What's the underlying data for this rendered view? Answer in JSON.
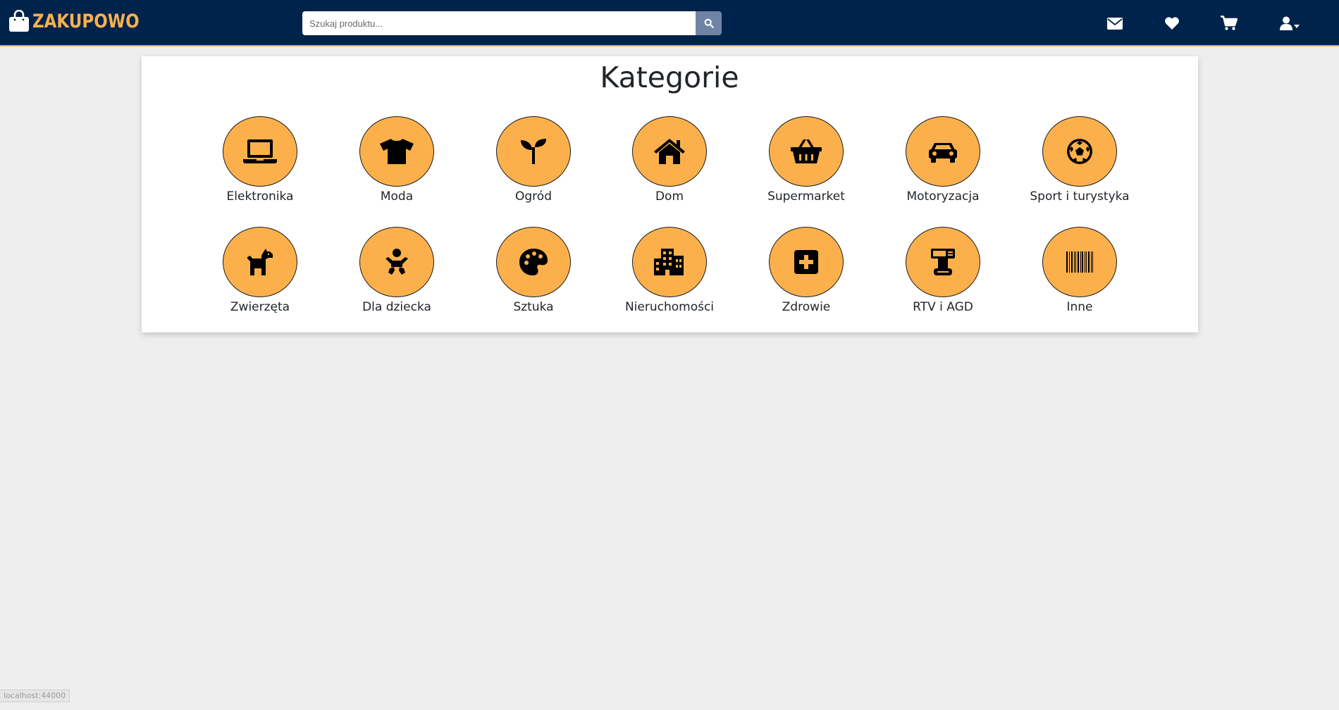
{
  "header": {
    "brand": "ZAKUPOWO",
    "search_placeholder": "Szukaj produktu...",
    "colors": {
      "background": "#00234b",
      "accent": "#f8b04d",
      "search_button": "#6f84a5"
    },
    "icons": [
      "envelope-icon",
      "heart-icon",
      "cart-icon",
      "user-icon"
    ]
  },
  "main": {
    "title": "Kategorie",
    "category_color": "#fcb04c",
    "categories": [
      {
        "label": "Elektronika",
        "icon": "laptop-icon"
      },
      {
        "label": "Moda",
        "icon": "tshirt-icon"
      },
      {
        "label": "Ogród",
        "icon": "seedling-icon"
      },
      {
        "label": "Dom",
        "icon": "home-icon"
      },
      {
        "label": "Supermarket",
        "icon": "basket-icon"
      },
      {
        "label": "Motoryzacja",
        "icon": "car-icon"
      },
      {
        "label": "Sport i turystyka",
        "icon": "football-icon"
      },
      {
        "label": "Zwierzęta",
        "icon": "dog-icon"
      },
      {
        "label": "Dla dziecka",
        "icon": "baby-icon"
      },
      {
        "label": "Sztuka",
        "icon": "palette-icon"
      },
      {
        "label": "Nieruchomości",
        "icon": "building-icon"
      },
      {
        "label": "Zdrowie",
        "icon": "medkit-icon"
      },
      {
        "label": "RTV i AGD",
        "icon": "appliance-icon"
      },
      {
        "label": "Inne",
        "icon": "barcode-icon"
      }
    ]
  },
  "status_bar": {
    "url": "localhost:44000"
  }
}
